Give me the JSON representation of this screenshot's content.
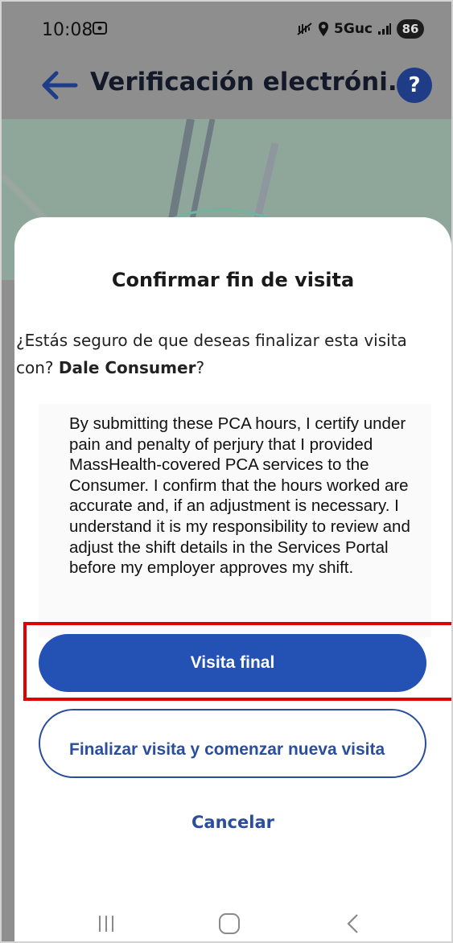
{
  "status_bar": {
    "time": "10:08",
    "network": "5Guc",
    "battery": "86"
  },
  "app_bar": {
    "title": "Verificación electróni...",
    "help_symbol": "?"
  },
  "dialog": {
    "title": "Confirmar fin de visita",
    "question_prefix": "¿Estás seguro de que deseas finalizar esta visita con? ",
    "consumer_name": "Dale Consumer",
    "question_suffix": "?",
    "certification_text": "By submitting these PCA hours, I certify under pain and penalty of perjury that I provided MassHealth-covered PCA services to the Consumer. I confirm that the hours worked are accurate and, if an adjustment is necessary. I understand it is my responsibility to review and adjust the shift details in the Services Portal before my employer approves my shift.",
    "primary_button": "Visita final",
    "secondary_button": "Finalizar visita y comenzar nueva visita",
    "cancel_button": "Cancelar"
  },
  "colors": {
    "primary": "#2451b4",
    "outline": "#2a4e9c",
    "highlight": "#e00000",
    "scrim": "#8e8e8e",
    "map": "#8fa79a"
  },
  "icons": {
    "back": "arrow-left-icon",
    "help": "question-mark-icon",
    "nav_recents": "recents-icon",
    "nav_home": "home-icon",
    "nav_back": "chevron-left-icon"
  }
}
